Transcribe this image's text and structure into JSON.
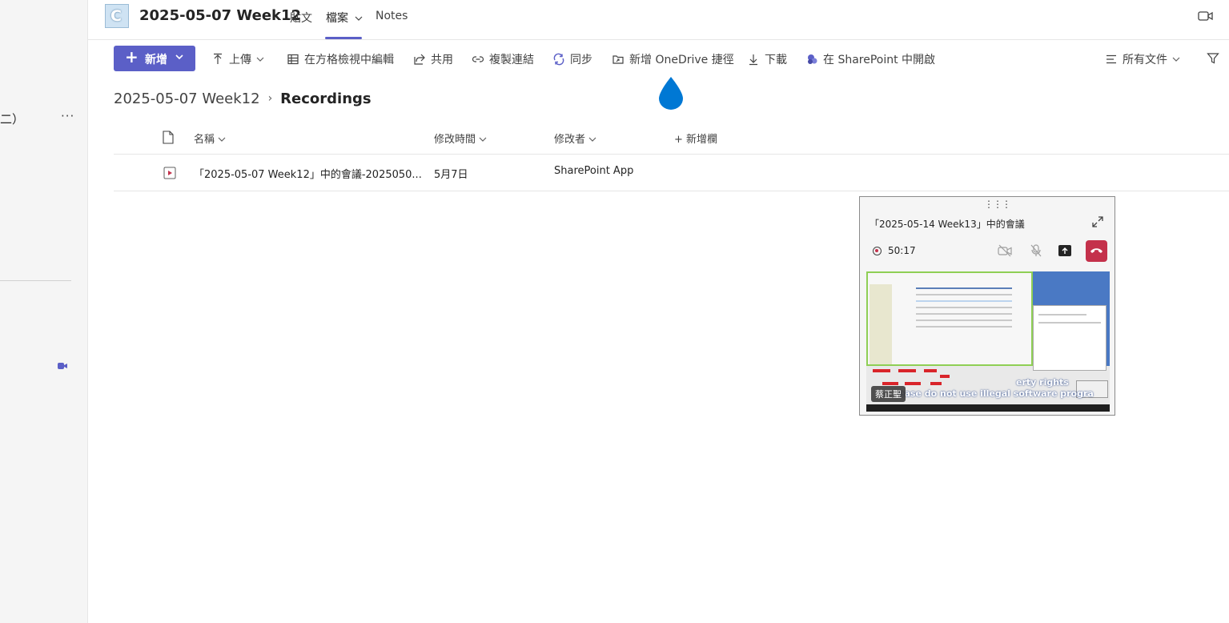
{
  "left_rail": {
    "fragment_text": "二）",
    "more_label": "···"
  },
  "header": {
    "team_title": "2025-05-07 Week12",
    "logo_letter": "C",
    "tabs": [
      {
        "label": "貼文",
        "active": false
      },
      {
        "label": "檔案",
        "active": true
      },
      {
        "label": "Notes",
        "active": false
      }
    ],
    "tab_chevron": "⌵"
  },
  "toolbar": {
    "new_label": "新增",
    "items": [
      {
        "label": "上傳",
        "icon": "upload-icon"
      },
      {
        "label": "在方格檢視中編輯",
        "icon": "grid-icon"
      },
      {
        "label": "共用",
        "icon": "share-icon"
      },
      {
        "label": "複製連結",
        "icon": "link-icon"
      },
      {
        "label": "同步",
        "icon": "sync-icon"
      },
      {
        "label": "新增 OneDrive 捷徑",
        "icon": "onedrive-shortcut-icon"
      },
      {
        "label": "下載",
        "icon": "download-icon"
      },
      {
        "label": "在 SharePoint 中開啟",
        "icon": "sharepoint-icon"
      }
    ],
    "view_label": "所有文件"
  },
  "breadcrumb": {
    "parent": "2025-05-07 Week12",
    "current": "Recordings"
  },
  "table": {
    "columns": {
      "name": "名稱",
      "modified": "修改時間",
      "modified_by": "修改者",
      "add_column": "新增欄"
    },
    "rows": [
      {
        "name": "「2025-05-07 Week12」中的會議-2025050...",
        "modified": "5月7日",
        "modified_by": "SharePoint App"
      }
    ]
  },
  "mini_call": {
    "title": "「2025-05-14 Week13」中的會議",
    "timer": "50:17",
    "speaker": "蔡正聖",
    "subtitle_top": "erty rights",
    "subtitle_bottom": "ease do not use illegal software progra"
  },
  "colors": {
    "accent": "#5b5fc7",
    "hangup": "#c4314b",
    "onedrive": "#0078d4",
    "video_file": "#c4314b"
  }
}
